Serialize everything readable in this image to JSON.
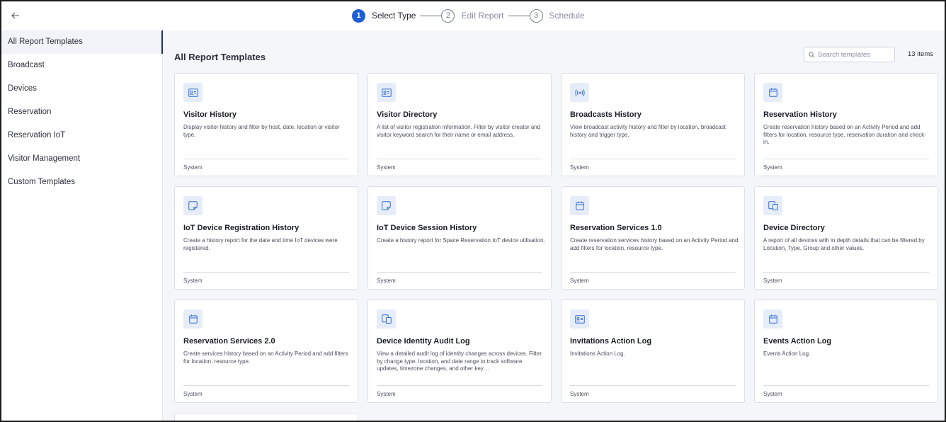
{
  "stepper": {
    "steps": [
      {
        "number": "1",
        "label": "Select Type"
      },
      {
        "number": "2",
        "label": "Edit Report"
      },
      {
        "number": "3",
        "label": "Schedule"
      }
    ]
  },
  "sidebar": {
    "items": [
      {
        "label": "All Report Templates"
      },
      {
        "label": "Broadcast"
      },
      {
        "label": "Devices"
      },
      {
        "label": "Reservation"
      },
      {
        "label": "Reservation IoT"
      },
      {
        "label": "Visitor Management"
      },
      {
        "label": "Custom Templates"
      }
    ]
  },
  "main": {
    "title": "All Report Templates",
    "search_placeholder": "Search templates",
    "count": "13 items",
    "cards": [
      {
        "icon": "id-card-icon",
        "title": "Visitor History",
        "desc": "Display visitor history and filter by host, date, location or visitor type.",
        "footer": "System"
      },
      {
        "icon": "id-card-icon",
        "title": "Visitor Directory",
        "desc": "A list of visitor registration information. Filter by visitor creator and visitor keyword search for their name or email address.",
        "footer": "System"
      },
      {
        "icon": "broadcast-icon",
        "title": "Broadcasts History",
        "desc": "View broadcast activity history and filter by location, broadcast history and trigger type.",
        "footer": "System"
      },
      {
        "icon": "calendar-icon",
        "title": "Reservation History",
        "desc": "Create reservation history based on an Activity Period and add filters for location, resource type, reservation duration and check-in.",
        "footer": "System"
      },
      {
        "icon": "sticky-note-icon",
        "title": "IoT Device Registration History",
        "desc": "Create a history report for the date and time IoT devices were registered.",
        "footer": "System"
      },
      {
        "icon": "sticky-note-icon",
        "title": "IoT Device Session History",
        "desc": "Create a history report for Space Reservation IoT device utilisation.",
        "footer": "System"
      },
      {
        "icon": "calendar-icon",
        "title": "Reservation Services 1.0",
        "desc": "Create reservation services history based on an Activity Period and add filters for location, resource type.",
        "footer": "System"
      },
      {
        "icon": "devices-icon",
        "title": "Device Directory",
        "desc": "A report of all devices with in depth details that can be filtered by Location, Type, Group and other values.",
        "footer": "System"
      },
      {
        "icon": "calendar-icon",
        "title": "Reservation Services 2.0",
        "desc": "Create services history based on an Activity Period and add filters for location, resource type.",
        "footer": "System"
      },
      {
        "icon": "devices-icon",
        "title": "Device Identity Audit Log",
        "desc": "View a detailed audit log of identity changes across devices. Filter by change type, location, and date range to track software updates, timezone changes, and other key…",
        "footer": "System"
      },
      {
        "icon": "id-card-icon",
        "title": "Invitations Action Log",
        "desc": "Invitations Action Log.",
        "footer": "System"
      },
      {
        "icon": "calendar-icon",
        "title": "Events Action Log",
        "desc": "Events Action Log.",
        "footer": "System"
      }
    ]
  },
  "colors": {
    "accent": "#1d5fd6",
    "icon_bg": "#e6edf8",
    "icon_fg": "#2f6bd3",
    "page_bg": "#f5f6fa"
  }
}
